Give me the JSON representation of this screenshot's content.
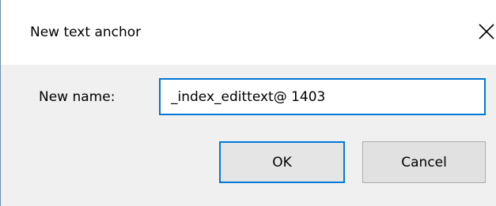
{
  "dialog": {
    "title": "New text anchor",
    "close_icon": "close-icon",
    "name_label": "New name:",
    "name_value": "_index_edittext@ 1403",
    "ok_label": "OK",
    "cancel_label": "Cancel"
  },
  "colors": {
    "titlebar_background": "#ffffff",
    "body_background": "#f0f0f0",
    "focus_accent": "#0078d7",
    "button_background": "#e1e1e1",
    "button_border": "#adadad"
  }
}
